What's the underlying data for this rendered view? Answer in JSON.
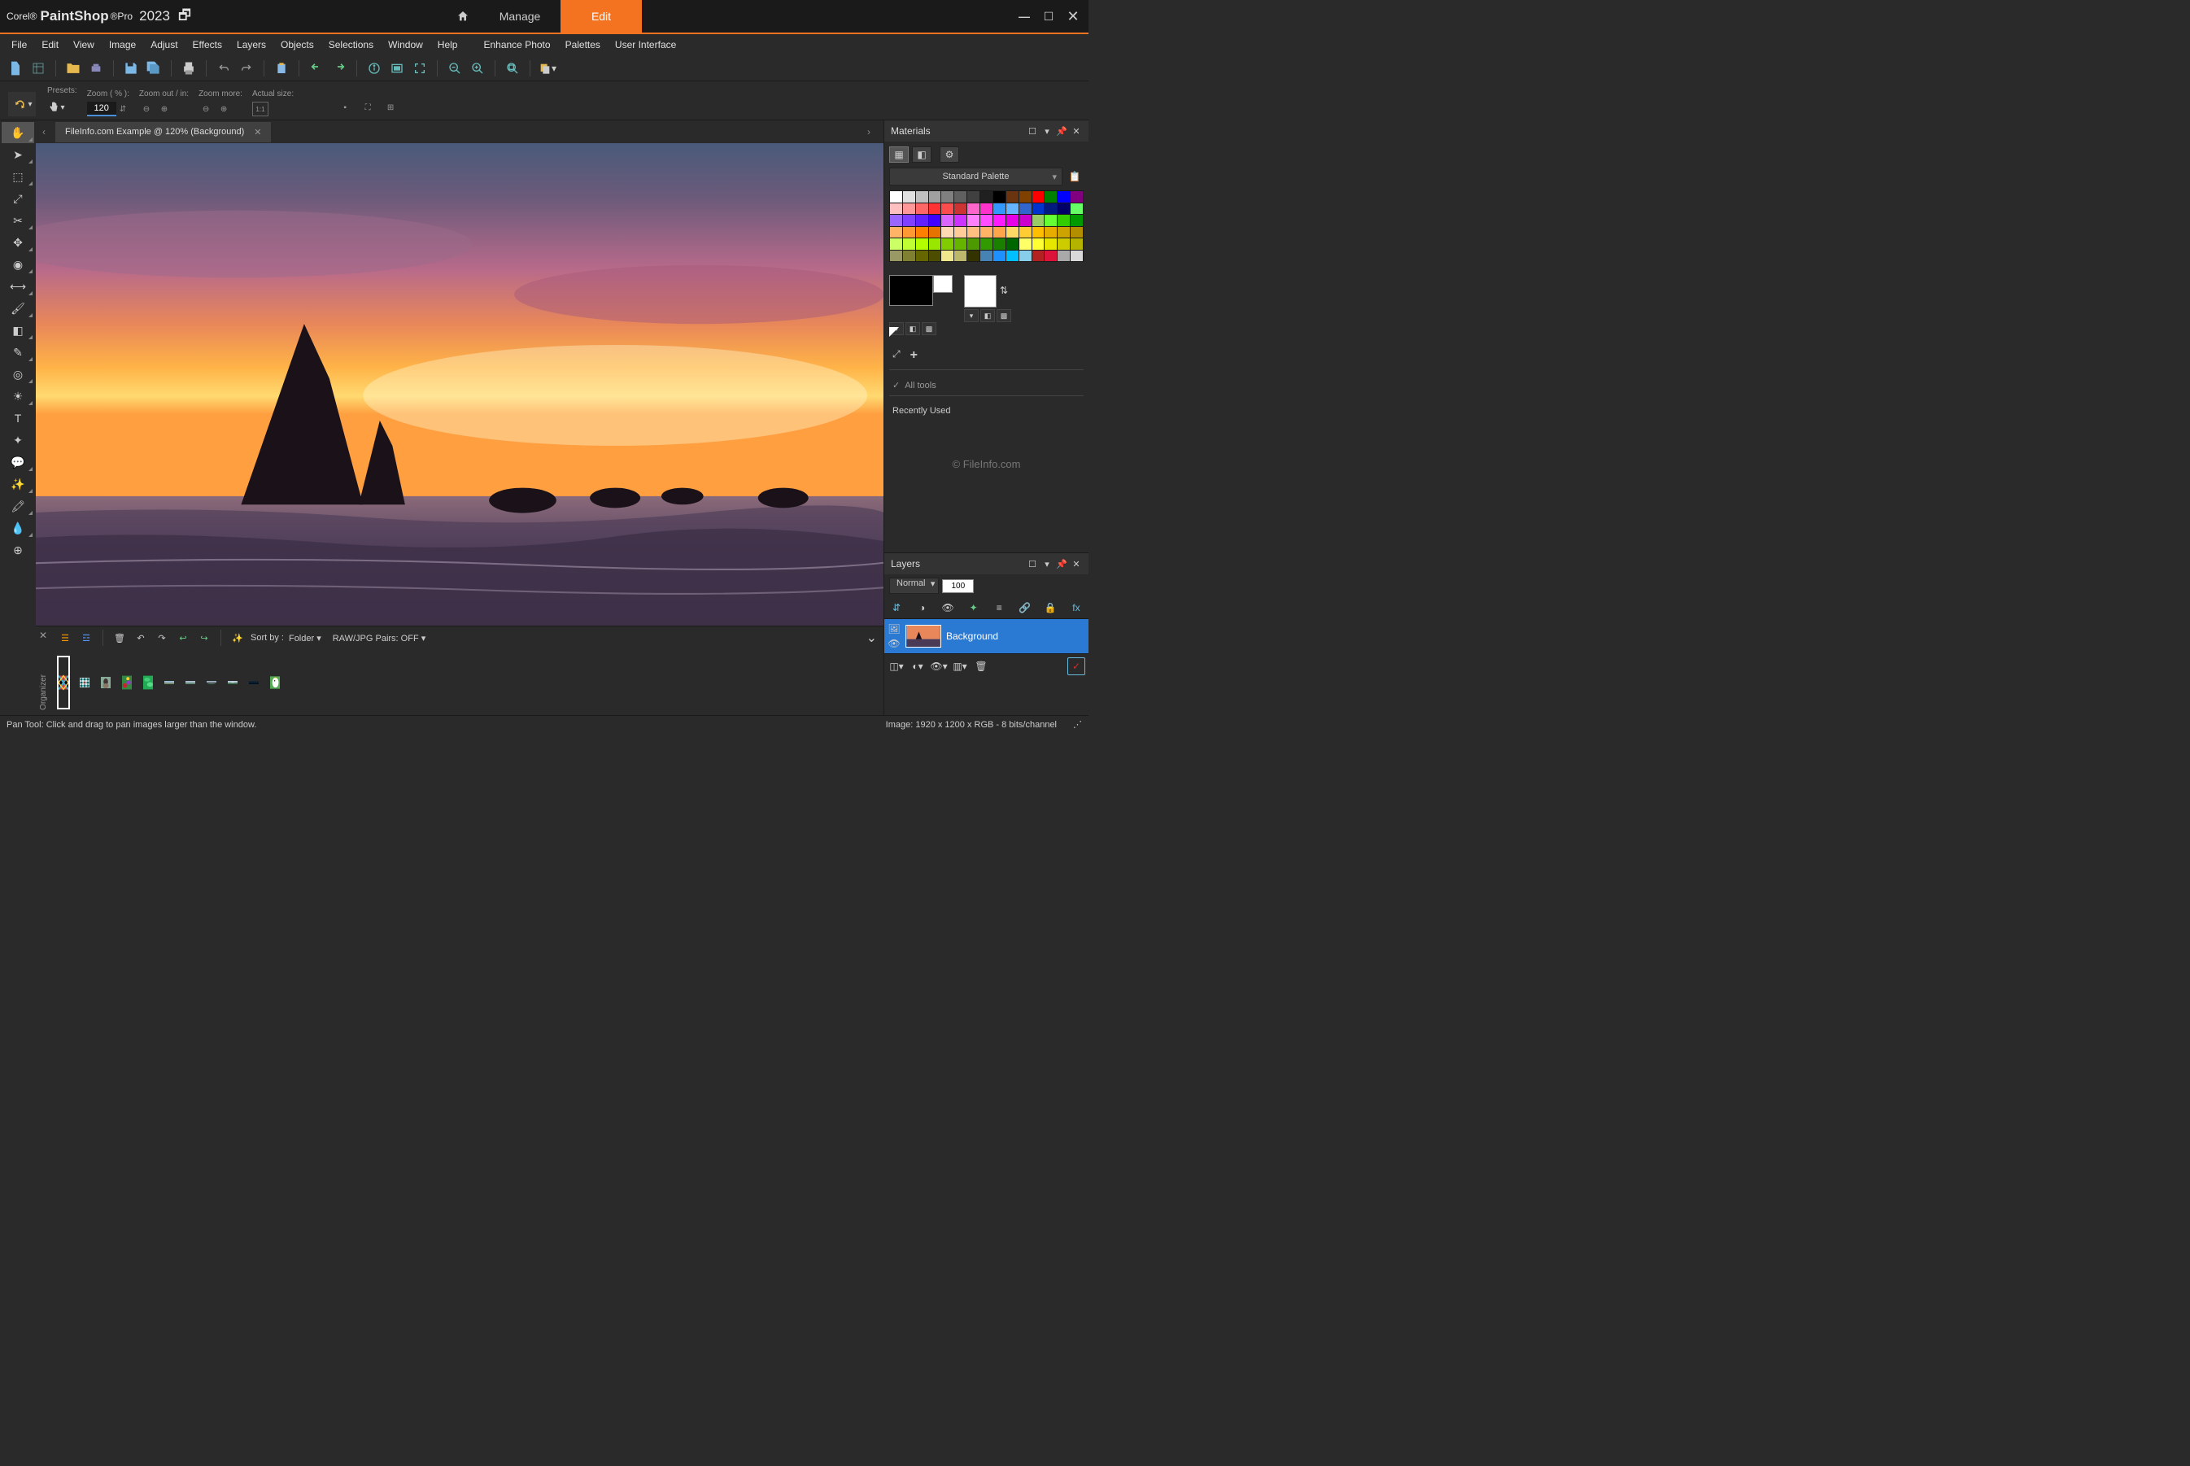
{
  "titlebar": {
    "brand_pre": "Corel®",
    "brand_main": "PaintShop",
    "brand_suffix": "®Pro",
    "year": "2023",
    "tabs": {
      "manage": "Manage",
      "edit": "Edit"
    }
  },
  "menubar": [
    "File",
    "Edit",
    "View",
    "Image",
    "Adjust",
    "Effects",
    "Layers",
    "Objects",
    "Selections",
    "Window",
    "Help",
    "Enhance Photo",
    "Palettes",
    "User Interface"
  ],
  "options_bar": {
    "presets_label": "Presets:",
    "zoom_label": "Zoom ( % ):",
    "zoom_value": "120",
    "zoom_out_in_label": "Zoom out / in:",
    "zoom_more_label": "Zoom more:",
    "actual_size_label": "Actual size:"
  },
  "document": {
    "tab_label": "FileInfo.com Example @ 120% (Background)"
  },
  "toolbox": [
    {
      "name": "pan-tool",
      "active": true,
      "fly": true
    },
    {
      "name": "pointer-tool",
      "fly": true
    },
    {
      "name": "selection-tool",
      "fly": true
    },
    {
      "name": "dropper-tool",
      "fly": false
    },
    {
      "name": "crop-tool",
      "fly": true
    },
    {
      "name": "move-tool",
      "fly": true
    },
    {
      "name": "redeye-tool",
      "fly": true
    },
    {
      "name": "straighten-tool",
      "fly": true
    },
    {
      "name": "paint-brush-tool",
      "fly": true
    },
    {
      "name": "gradient-tool",
      "fly": true
    },
    {
      "name": "pencil-tool",
      "fly": true
    },
    {
      "name": "clone-tool",
      "fly": true
    },
    {
      "name": "dodge-tool",
      "fly": true
    },
    {
      "name": "text-tool",
      "fly": false
    },
    {
      "name": "shape-tool",
      "fly": false
    },
    {
      "name": "speech-tool",
      "fly": true
    },
    {
      "name": "retouch-tool",
      "fly": true
    },
    {
      "name": "smart-brush-tool",
      "fly": true
    },
    {
      "name": "color-replace-tool",
      "fly": true
    },
    {
      "name": "add-tool",
      "fly": false
    }
  ],
  "organizer": {
    "title": "Organizer",
    "sort_by_label": "Sort by :",
    "sort_value": "Folder",
    "raw_jpg_label": "RAW/JPG Pairs: OFF"
  },
  "materials": {
    "title": "Materials",
    "palette_name": "Standard Palette",
    "all_tools": "All tools",
    "recently_used": "Recently Used",
    "watermark": "© FileInfo.com",
    "swatches": [
      "#ffffff",
      "#e0e0e0",
      "#c0c0c0",
      "#a0a0a0",
      "#808080",
      "#606060",
      "#404040",
      "#202020",
      "#000000",
      "#6b3410",
      "#804000",
      "#ff0000",
      "#008000",
      "#0000ff",
      "#800080",
      "#ffc0c0",
      "#ff9999",
      "#ff6666",
      "#ff3333",
      "#ff4d4d",
      "#cc3333",
      "#ff66cc",
      "#ff33cc",
      "#3399ff",
      "#66b3ff",
      "#3366cc",
      "#0033cc",
      "#001a80",
      "#000066",
      "#66ff66",
      "#9966ff",
      "#8040ff",
      "#6020ff",
      "#4000ff",
      "#d966ff",
      "#cc33ff",
      "#ff80ff",
      "#ff4dff",
      "#ff1aff",
      "#e600e6",
      "#cc00cc",
      "#99cc66",
      "#66ff33",
      "#33cc00",
      "#009900",
      "#ffb366",
      "#ff9933",
      "#ff8000",
      "#e67300",
      "#ffd9b3",
      "#ffcc99",
      "#ffbf80",
      "#ffb366",
      "#ffa64d",
      "#ffd966",
      "#ffcc33",
      "#ffbf00",
      "#e6ac00",
      "#cca300",
      "#b38f00",
      "#ccff66",
      "#bfff33",
      "#b3ff00",
      "#99e600",
      "#80cc00",
      "#66b300",
      "#4d9900",
      "#339900",
      "#1a8000",
      "#006600",
      "#ffff66",
      "#ffff33",
      "#e6e600",
      "#cccc00",
      "#b3b300",
      "#999966",
      "#808033",
      "#666600",
      "#4d4d00",
      "#f0e68c",
      "#bdb76b",
      "#333300",
      "#4682b4",
      "#1e90ff",
      "#00bfff",
      "#87ceeb",
      "#b22222",
      "#dc143c",
      "#a9a9a9",
      "#d9d9d9"
    ]
  },
  "layers": {
    "title": "Layers",
    "blend_mode": "Normal",
    "opacity": "100",
    "layer_name": "Background"
  },
  "statusbar": {
    "hint": "Pan Tool: Click and drag to pan images larger than the window.",
    "image_info": "Image:  1920 x 1200 x RGB - 8 bits/channel"
  }
}
